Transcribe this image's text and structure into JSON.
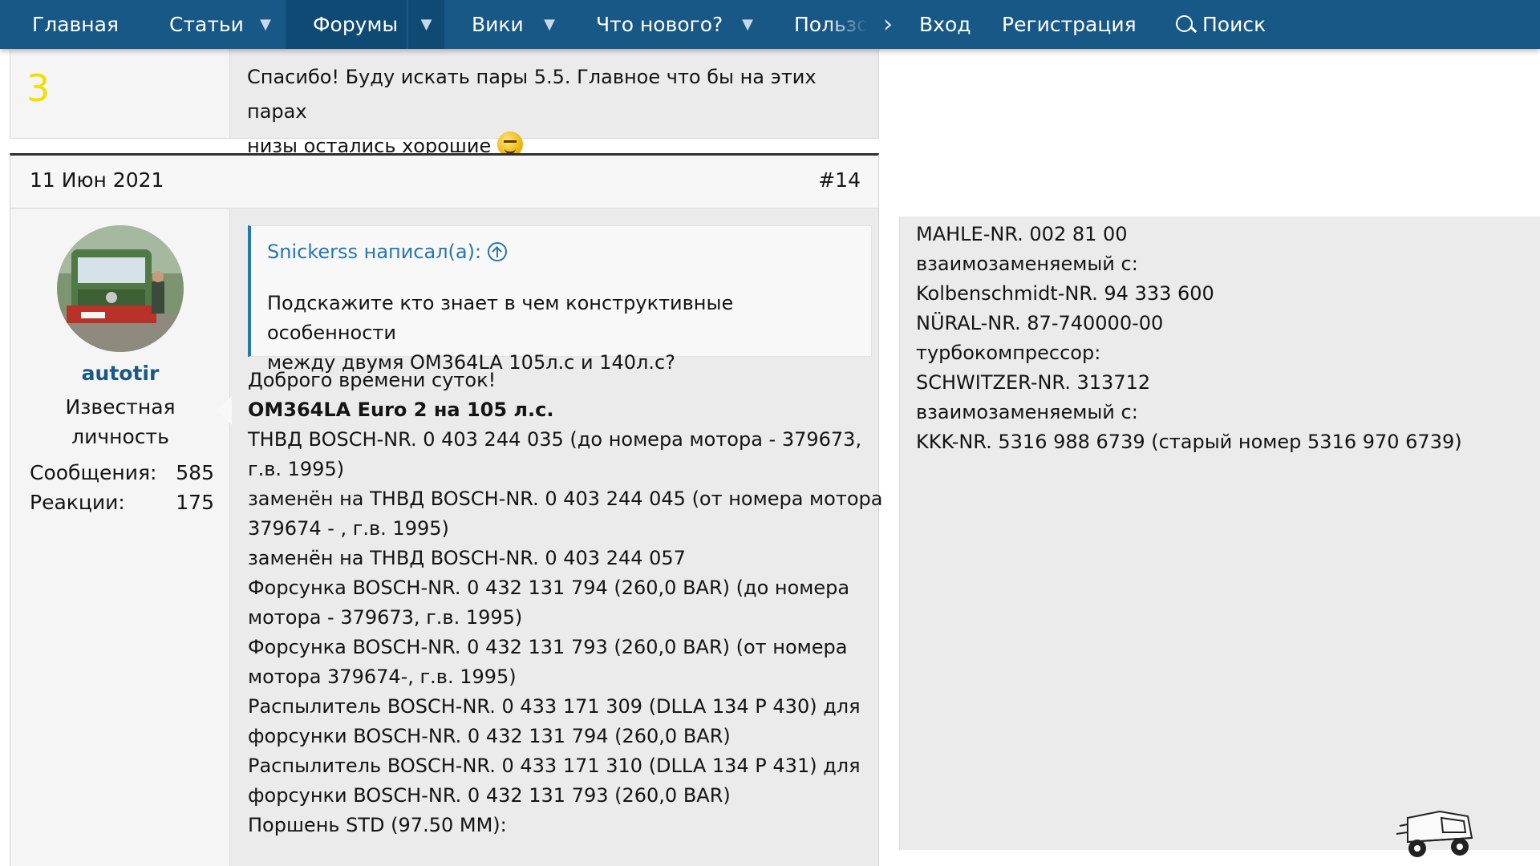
{
  "nav": {
    "items": [
      {
        "label": "Главная"
      },
      {
        "label": "Статьи"
      },
      {
        "label": "Форумы"
      },
      {
        "label": "Вики"
      },
      {
        "label": "Что нового?"
      },
      {
        "label": "Пользо"
      }
    ],
    "login": "Вход",
    "register": "Регистрация",
    "search": "Поиск"
  },
  "post13": {
    "number_label": "3",
    "text_line1": "Спасибо! Буду искать пары 5.5. Главное что бы на этих парах",
    "text_line2": "низы остались хорошие"
  },
  "post14": {
    "date": "11 Июн 2021",
    "post_number": "#14",
    "user": {
      "name": "autotir",
      "title_line1": "Известная",
      "title_line2": "личность",
      "messages_label": "Сообщения:",
      "messages_value": "585",
      "reactions_label": "Реакции:",
      "reactions_value": "175"
    },
    "quote": {
      "author": "Snickerss написал(а):",
      "line1": "Подскажите кто знает в чем конструктивные особенности",
      "line2": "между двумя ОМ364LA 105л.с и 140л.с?"
    },
    "body": [
      "Доброго времени суток!",
      "OM364LA Euro 2 на 105 л.с.",
      "ТНВД BOSCH-NR. 0 403 244 035 (до номера мотора - 379673,",
      "г.в. 1995)",
      "заменён на ТНВД BOSCH-NR. 0 403 244 045 (от номера мотора",
      "379674 - , г.в. 1995)",
      "заменён на ТНВД BOSCH-NR. 0 403 244 057",
      "Форсунка BOSCH-NR. 0 432 131 794 (260,0 BAR) (до номера",
      "мотора - 379673, г.в. 1995)",
      "Форсунка BOSCH-NR. 0 432 131 793 (260,0 BAR) (от номера",
      "мотора 379674-, г.в. 1995)",
      "Распылитель BOSCH-NR. 0 433 171 309 (DLLA 134 P 430) для",
      "форсунки BOSCH-NR. 0 432 131 794 (260,0 BAR)",
      "Распылитель BOSCH-NR. 0 433 171 310 (DLLA 134 P 431) для",
      "форсунки BOSCH-NR. 0 432 131 793 (260,0 BAR)",
      "Поршень STD (97.50 MM):"
    ]
  },
  "right_panel": {
    "lines": [
      "MAHLE-NR. 002 81 00",
      "взаимозаменяемый с:",
      "Kolbenschmidt-NR. 94 333 600",
      "NÜRAL-NR. 87-740000-00",
      "турбокомпрессор:",
      "SCHWITZER-NR. 313712",
      "взаимозаменяемый с:",
      "KKK-NR. 5316 988 6739 (старый номер 5316 970 6739)"
    ]
  },
  "colors": {
    "nav_bg": "#185886",
    "link_blue": "#2577b1",
    "username_blue": "#185886",
    "post_number_yellow": "#f0e000"
  }
}
